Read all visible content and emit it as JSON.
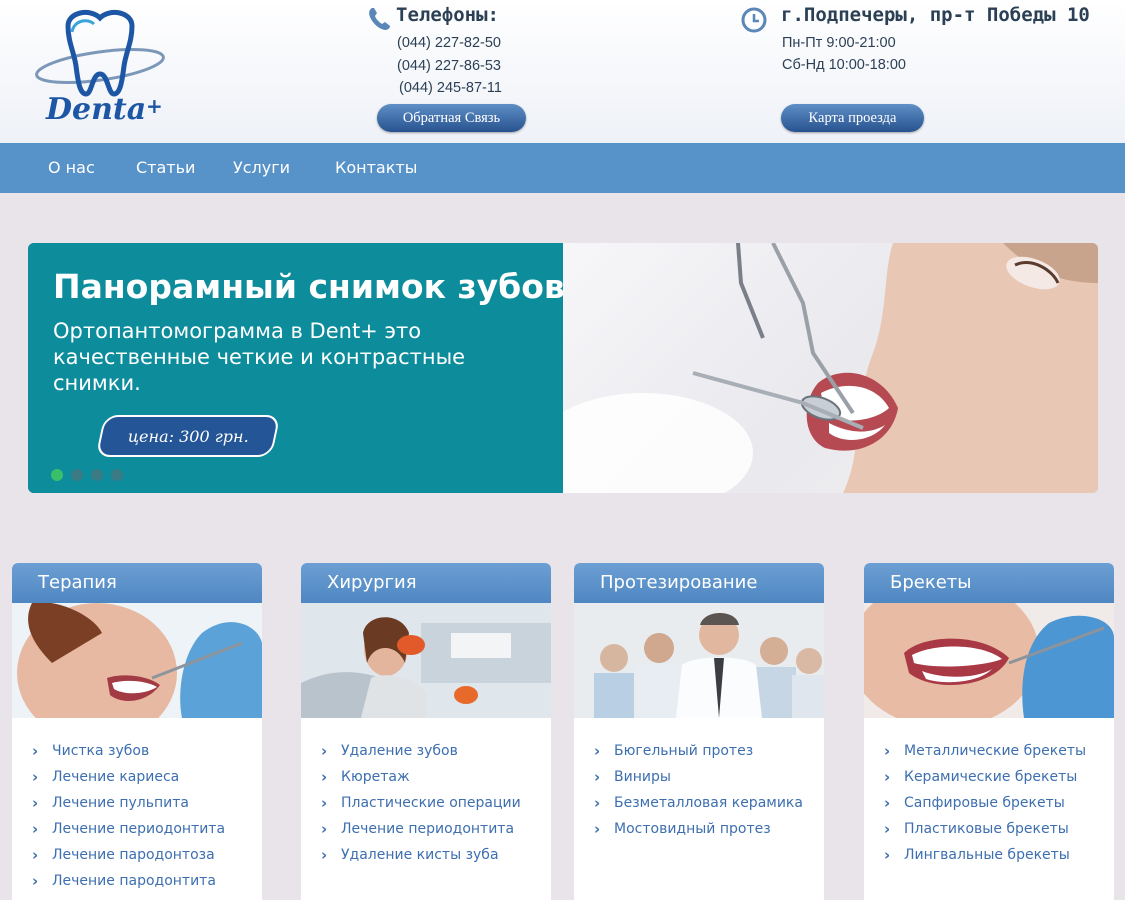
{
  "header": {
    "logo_text": "Denta",
    "logo_plus": "+",
    "phones_title": "Телефоны:",
    "phones": [
      "(044) 227-82-50",
      "(044) 227-86-53",
      "(044) 245-87-11"
    ],
    "feedback_button": "Обратная Связь",
    "address": "г.Подпечеры, пр-т Победы 10",
    "hours": [
      "Пн-Пт 9:00-21:00",
      "Сб-Нд 10:00-18:00"
    ],
    "map_button": "Карта проезда"
  },
  "nav": {
    "items": [
      "О нас",
      "Статьи",
      "Услуги",
      "Контакты"
    ]
  },
  "slider": {
    "title": "Панорамный снимок зубов",
    "description": "Ортопантомограмма в Dent+ это качественные четкие и контрастные снимки.",
    "price": "цена: 300 грн.",
    "active_slide": 1,
    "slide_count": 4
  },
  "cards": [
    {
      "title": "Терапия",
      "items": [
        "Чистка зубов",
        "Лечение кариеса",
        "Лечение пульпита",
        "Лечение периодонтита",
        "Лечение пародонтоза",
        "Лечение пародонтита"
      ]
    },
    {
      "title": "Хирургия",
      "items": [
        "Удаление зубов",
        "Кюретаж",
        "Пластические операции",
        "Лечение периодонтита",
        "Удаление кисты зуба"
      ]
    },
    {
      "title": "Протезирование",
      "items": [
        "Бюгельный протез",
        "Виниры",
        "Безметалловая керамика",
        "Мостовидный протез"
      ]
    },
    {
      "title": "Брекеты",
      "items": [
        "Металлические брекеты",
        "Керамические брекеты",
        "Сапфировые брекеты",
        "Пластиковые брекеты",
        "Лингвальные брекеты"
      ]
    }
  ],
  "colors": {
    "nav": "#5792c9",
    "slide_bg": "#0d8c9c",
    "link": "#3d6fb0",
    "button": "#27528f",
    "page_bg": "#e8e4ea"
  },
  "icons": [
    "tooth-logo-icon",
    "phone-icon",
    "clock-icon",
    "chevron-right-icon"
  ]
}
